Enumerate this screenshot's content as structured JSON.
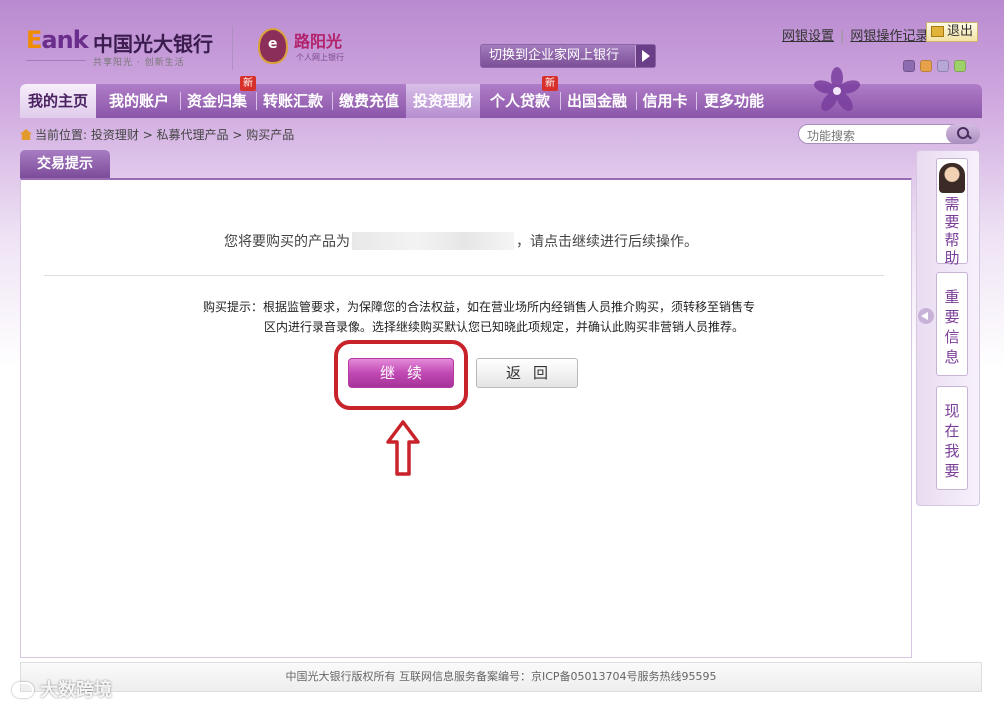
{
  "header": {
    "logo_e": "E",
    "logo_ank": "ank",
    "bank_name": "中国光大银行",
    "slogan": "共享阳光 · 创新生活",
    "sub_brand": "路阳光",
    "sub_brand_caption": "个人网上银行",
    "switch_button": "切换到企业家网上银行",
    "links": {
      "settings": "网银设置",
      "records": "网银操作记录"
    },
    "logout": "退出",
    "skin_colors": [
      "#8e6bb0",
      "#e6a14a",
      "#b7a6d8",
      "#9fd16b"
    ]
  },
  "nav": {
    "items": [
      {
        "label": "我的主页"
      },
      {
        "label": "我的账户"
      },
      {
        "label": "资金归集",
        "new": "新"
      },
      {
        "label": "转账汇款"
      },
      {
        "label": "缴费充值"
      },
      {
        "label": "投资理财"
      },
      {
        "label": "个人贷款",
        "new": "新"
      },
      {
        "label": "出国金融"
      },
      {
        "label": "信用卡"
      },
      {
        "label": "更多功能"
      }
    ]
  },
  "breadcrumb": {
    "prefix": "当前位置:",
    "path": "投资理财 > 私募代理产品 > 购买产品"
  },
  "search": {
    "placeholder": "功能搜索"
  },
  "main": {
    "tab": "交易提示",
    "notice_before": "您将要购买的产品为",
    "notice_after": "，请点击继续进行后续操作。",
    "tip_line1": "购买提示：根据监管要求，为保障您的合法权益，如在营业场所内经销售人员推介购买，须转移至销售专",
    "tip_line2": "区内进行录音录像。选择继续购买默认您已知晓此项规定，并确认此购买非营销人员推荐。",
    "continue_label": "继续",
    "back_label": "返回"
  },
  "side": {
    "help": "需要帮助",
    "important": "重要信息",
    "want": "现在我要"
  },
  "footer": {
    "text": "中国光大银行版权所有 互联网信息服务备案编号：京ICP备05013704号服务热线95595"
  },
  "watermark": "大数跨境",
  "colors": {
    "brand_purple": "#8a55a8",
    "highlight_red": "#c8232a",
    "continue_magenta": "#c049b4"
  }
}
